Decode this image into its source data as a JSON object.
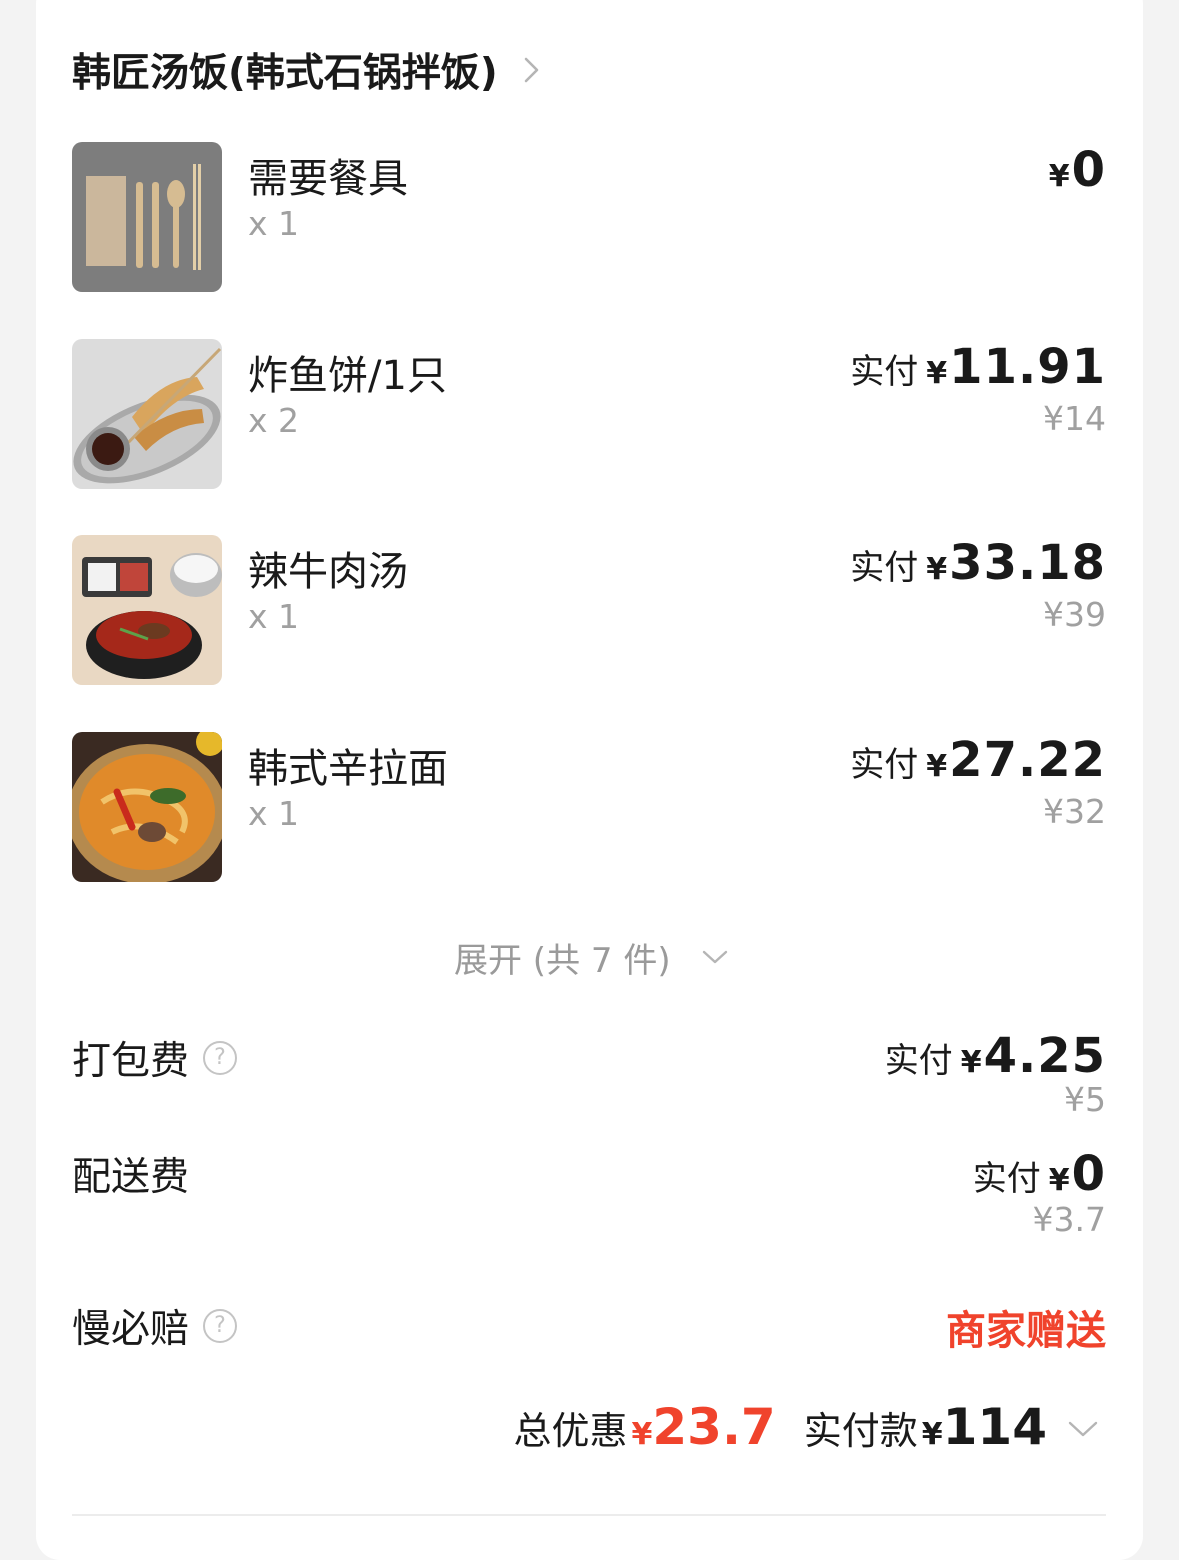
{
  "shop": {
    "name": "韩匠汤饭(韩式石锅拌饭)"
  },
  "items": [
    {
      "name": "需要餐具",
      "qty": "x 1",
      "price_label": "",
      "price": "0",
      "original": ""
    },
    {
      "name": "炸鱼饼/1只",
      "qty": "x 2",
      "price_label": "实付",
      "price": "11.91",
      "original": "¥14"
    },
    {
      "name": "辣牛肉汤",
      "qty": "x 1",
      "price_label": "实付",
      "price": "33.18",
      "original": "¥39"
    },
    {
      "name": "韩式辛拉面",
      "qty": "x 1",
      "price_label": "实付",
      "price": "27.22",
      "original": "¥32"
    }
  ],
  "currency": "¥",
  "expand": {
    "label": "展开 (共 7 件)"
  },
  "fees": {
    "packing": {
      "label": "打包费",
      "price_label": "实付",
      "price": "4.25",
      "original": "¥5"
    },
    "delivery": {
      "label": "配送费",
      "price_label": "实付",
      "price": "0",
      "original": "¥3.7"
    },
    "late_guarantee": {
      "label": "慢必赔",
      "value": "商家赠送"
    }
  },
  "summary": {
    "discount_label": "总优惠",
    "discount": "23.7",
    "paid_label": "实付款",
    "paid": "114"
  },
  "colors": {
    "accent_red": "#f0432c",
    "text_primary": "#1a1a1a",
    "text_muted": "#a0a0a0"
  },
  "icons": [
    "chevron-right-icon",
    "chevron-down-icon",
    "help-icon"
  ]
}
